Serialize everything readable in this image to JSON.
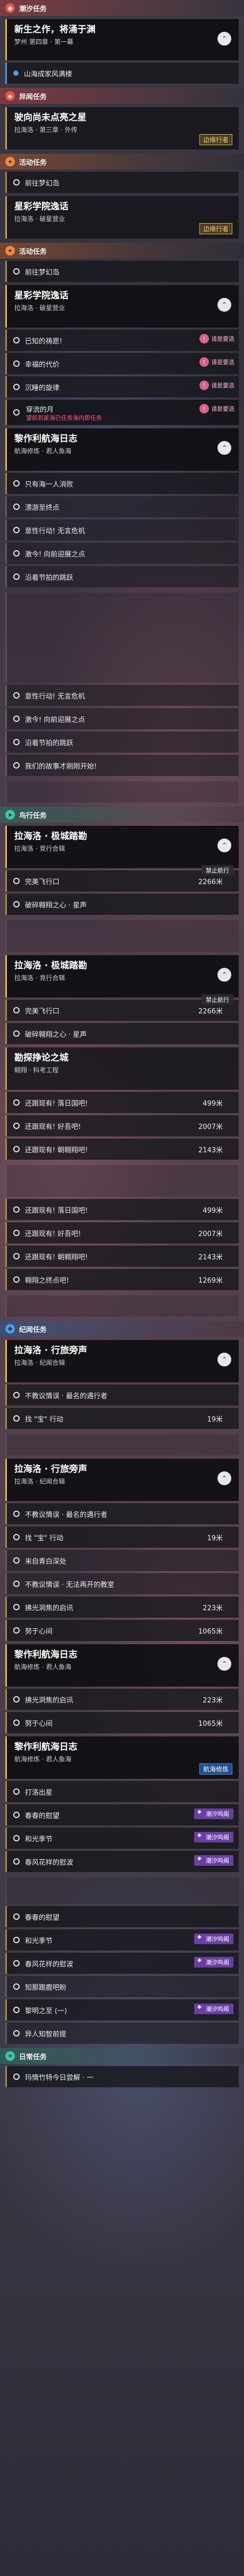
{
  "sections": {
    "chao": "潮汐任务",
    "yiwen": "异闻任务",
    "huodong1": "活动任务",
    "huodong2": "活动任务",
    "niaoxing": "鸟行任务",
    "jiyu": "纪闻任务",
    "zhinan": "日常任务"
  },
  "chao": {
    "title": "新生之作，将涌于渊",
    "sub": "梦州 第四章 · 第一幕",
    "obj1": "山海成家风满楼"
  },
  "yiwen": {
    "title": "驶向尚未点亮之星",
    "sub": "拉海洛 · 第三章 · 外传",
    "tag": "边缘行者"
  },
  "huodong1": {
    "obj": "前往梦幻岛",
    "title": "星彩学院逸话",
    "sub": "拉海洛 · 破星营业",
    "tag": "边缘行者"
  },
  "huodong2": {
    "obj": "前往梦幻岛",
    "title": "星彩学院逸话",
    "sub": "拉海洛 · 破星营业",
    "items": [
      "已知的祷愿!",
      "幸福的代价",
      "沉睡的旋律"
    ],
    "warn": "请是要选"
  },
  "special": {
    "name": "穿流的月",
    "desc": "望前到星海已任务海内即任务",
    "warn": "请是要选"
  },
  "lanhai1": {
    "title": "黎作利航海日志",
    "sub": "航海修炼 · 君人鱼海",
    "items": [
      "只有海一人消败",
      "漂游至终点",
      "意性行动! 无言危机",
      "激今! 向前迎展之点",
      "沿着节拍的跳跃"
    ]
  },
  "special2": {
    "name": "穿流的月",
    "desc": "望前到星海已任务海内即任务",
    "warn": "请是要选"
  },
  "lanhai2": {
    "title": "黎作利航海日志",
    "sub": "航海修炼 · 君人鱼海",
    "items": [
      "只有海一人消败",
      "漂游至终点",
      "意性行动! 无言危机",
      "激今! 向前迎展之点",
      "沿着节拍的跳跃"
    ]
  },
  "lanhai2b": {
    "items": [
      "意性行动! 无言危机",
      "激今! 向前迎展之点",
      "沿着节拍的跳跃",
      "我们的故事才刚刚开始!"
    ]
  },
  "niaoxing": {
    "title": "拉海洛 · 极城踏勘",
    "sub": "拉海洛 · 竞行合辑",
    "ban": "禁止航行",
    "items": [
      {
        "t": "完美飞行口",
        "d": "2266米"
      },
      {
        "t": "破碎翱翔之心 · 星声",
        "d": ""
      }
    ]
  },
  "niaoxing2": {
    "title": "拉海洛 · 极城踏勘",
    "sub": "拉海洛 · 竞行合辑",
    "ban": "禁止航行",
    "items": [
      {
        "t": "完美飞行口",
        "d": "2266米"
      },
      {
        "t": "破碎翱翔之心 · 星声",
        "d": ""
      }
    ]
  },
  "xinlun": {
    "title": "勘探挣论之城",
    "sub": "翱翔 · 科考工程",
    "items": [
      {
        "t": "还跟现有! 落日国吧!",
        "d": "499米"
      },
      {
        "t": "还跟现有! 好吾吧!",
        "d": "2007米"
      },
      {
        "t": "还跟现有! 朝翱翔吧!",
        "d": "2143米"
      },
      {
        "t": "还跟现有! 落日国吧!",
        "d": "499米"
      },
      {
        "t": "还跟现有! 好吾吧!",
        "d": "2007米"
      },
      {
        "t": "还跟现有! 朝翱翔吧!",
        "d": "2143米"
      },
      {
        "t": "翱翔之终点吧!",
        "d": "1269米"
      }
    ]
  },
  "jiyu": {
    "title": "拉海洛 · 行旅旁声",
    "sub": "拉海洛 · 纪闻合辑",
    "items": [
      {
        "t": "不教议情误 · 最名的遇行者",
        "d": ""
      },
      {
        "t": "找 \"宝\" 行动",
        "d": "19米"
      }
    ]
  },
  "jiyu2": {
    "title": "拉海洛 · 行旅旁声",
    "sub": "拉海洛 · 纪闻合辑",
    "items": [
      {
        "t": "不教议情误 · 最名的遇行者",
        "d": ""
      },
      {
        "t": "找 \"宝\" 行动",
        "d": "19米"
      },
      {
        "t": "来自青白深处",
        "d": ""
      },
      {
        "t": "不教议情误 · 无法再开的教室",
        "d": ""
      },
      {
        "t": "拂光洞焦的启讯",
        "d": "223米"
      },
      {
        "t": "努于心间",
        "d": "1065米"
      }
    ]
  },
  "jiyu3": {
    "items": [
      {
        "t": "拂光洞焦的启讯",
        "d": "223米"
      },
      {
        "t": "努于心间",
        "d": "1065米"
      }
    ]
  },
  "lanhai3": {
    "title": "黎作利航海日志",
    "sub": "航海修炼 · 君人鱼海",
    "tag": "航海修炼",
    "items": [
      {
        "t": "打洛出星",
        "d": ""
      },
      {
        "t": "春春的慰望",
        "d": "",
        "tag": "潮汐鸣阁"
      },
      {
        "t": "和光季节",
        "d": "",
        "tag": "潮汐鸣阁"
      },
      {
        "t": "春风花样的慰波",
        "d": "",
        "tag": "潮汐鸣阁"
      }
    ]
  },
  "lanhai4": {
    "items": [
      {
        "t": "春春的慰望",
        "d": ""
      },
      {
        "t": "和光季节",
        "d": "",
        "tag": "潮汐鸣阁"
      },
      {
        "t": "春风花样的慰波",
        "d": "",
        "tag": "潮汐鸣阁"
      },
      {
        "t": "知那跟鹿吧盼",
        "d": ""
      },
      {
        "t": "黎明之至 (一)",
        "d": "",
        "tag": "潮汐鸣阁"
      },
      {
        "t": "异人知智前提",
        "d": ""
      }
    ]
  },
  "daily": {
    "item": "玛情竹特今日尝解 · 一"
  }
}
